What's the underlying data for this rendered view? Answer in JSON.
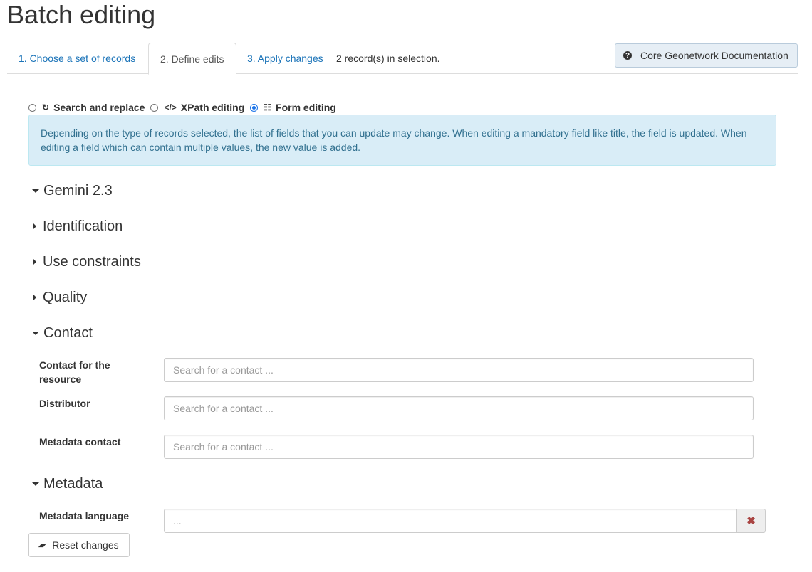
{
  "page": {
    "title": "Batch editing"
  },
  "tabs": [
    {
      "label": "1. Choose a set of records"
    },
    {
      "label": "2. Define edits"
    },
    {
      "label": "3. Apply changes"
    }
  ],
  "selection_count": "2 record(s) in selection.",
  "doc_button": {
    "label": "Core Geonetwork Documentation",
    "icon": "question-circle-icon"
  },
  "modes": [
    {
      "label": "Search and replace",
      "icon": "refresh-icon",
      "checked": false
    },
    {
      "label": "XPath editing",
      "icon": "code-icon",
      "checked": false
    },
    {
      "label": "Form editing",
      "icon": "list-alt-icon",
      "checked": true
    }
  ],
  "info_text": "Depending on the type of records selected, the list of fields that you can update may change. When editing a mandatory field like title, the field is updated. When editing a field which can contain multiple values, the new value is added.",
  "sections": {
    "gemini": {
      "label": "Gemini 2.3",
      "expanded": true
    },
    "identification": {
      "label": "Identification",
      "expanded": false
    },
    "use_constraints": {
      "label": "Use constraints",
      "expanded": false
    },
    "quality": {
      "label": "Quality",
      "expanded": false
    },
    "contact": {
      "label": "Contact",
      "expanded": true
    },
    "metadata": {
      "label": "Metadata",
      "expanded": true
    }
  },
  "contact_fields": {
    "resource_contact": {
      "label": "Contact for the resource",
      "placeholder": "Search for a contact ..."
    },
    "distributor": {
      "label": "Distributor",
      "placeholder": "Search for a contact ..."
    },
    "metadata_contact": {
      "label": "Metadata contact",
      "placeholder": "Search for a contact ..."
    }
  },
  "metadata_fields": {
    "language": {
      "label": "Metadata language",
      "placeholder": "..."
    }
  },
  "reset_button": {
    "label": "Reset changes"
  },
  "colors": {
    "link": "#1a73b8",
    "alert_bg": "#d9edf7",
    "alert_text": "#31708f",
    "danger": "#a94442"
  }
}
